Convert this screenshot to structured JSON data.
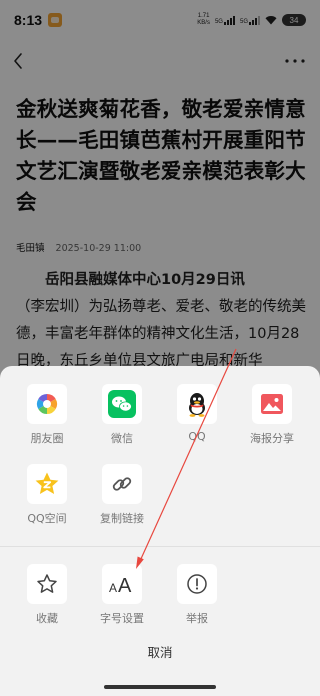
{
  "status_bar": {
    "time": "8:13",
    "net_speed_value": "1.71",
    "net_speed_unit": "KB/s",
    "signal_1": "5G",
    "signal_2": "5G",
    "battery": "34"
  },
  "article": {
    "title": "金秋送爽菊花香，敬老爱亲情意长——毛田镇芭蕉村开展重阳节文艺汇演暨敬老爱亲模范表彰大会",
    "source": "毛田镇",
    "date": "2025-10-29 11:00",
    "body_lead": "岳阳县融媒体中心10月29日讯",
    "body_author": "（李宏圳）",
    "body_text": "为弘扬尊老、爱老、敬老的传统美德，丰富老年群体的精神文化生活，10月28日晚，东丘乡单位县文旅广电局和新华"
  },
  "share_sheet": {
    "row1": [
      {
        "label": "朋友圈",
        "icon": "moments-icon"
      },
      {
        "label": "微信",
        "icon": "wechat-icon"
      },
      {
        "label": "QQ",
        "icon": "qq-icon"
      },
      {
        "label": "海报分享",
        "icon": "poster-share-icon"
      }
    ],
    "row2": [
      {
        "label": "QQ空间",
        "icon": "qzone-icon"
      },
      {
        "label": "复制链接",
        "icon": "link-icon"
      }
    ],
    "row3": [
      {
        "label": "收藏",
        "icon": "star-icon"
      },
      {
        "label": "字号设置",
        "icon": "font-size-icon",
        "glyph": "AA"
      },
      {
        "label": "举报",
        "icon": "report-icon"
      }
    ],
    "cancel": "取消"
  },
  "colors": {
    "overlay": "#000000",
    "sheet_bg": "#f2f2f2",
    "wechat_green": "#07c160",
    "poster_red": "#f0575d",
    "qzone_yellow": "#f8c21c",
    "annotation_arrow": "#e8483f"
  }
}
